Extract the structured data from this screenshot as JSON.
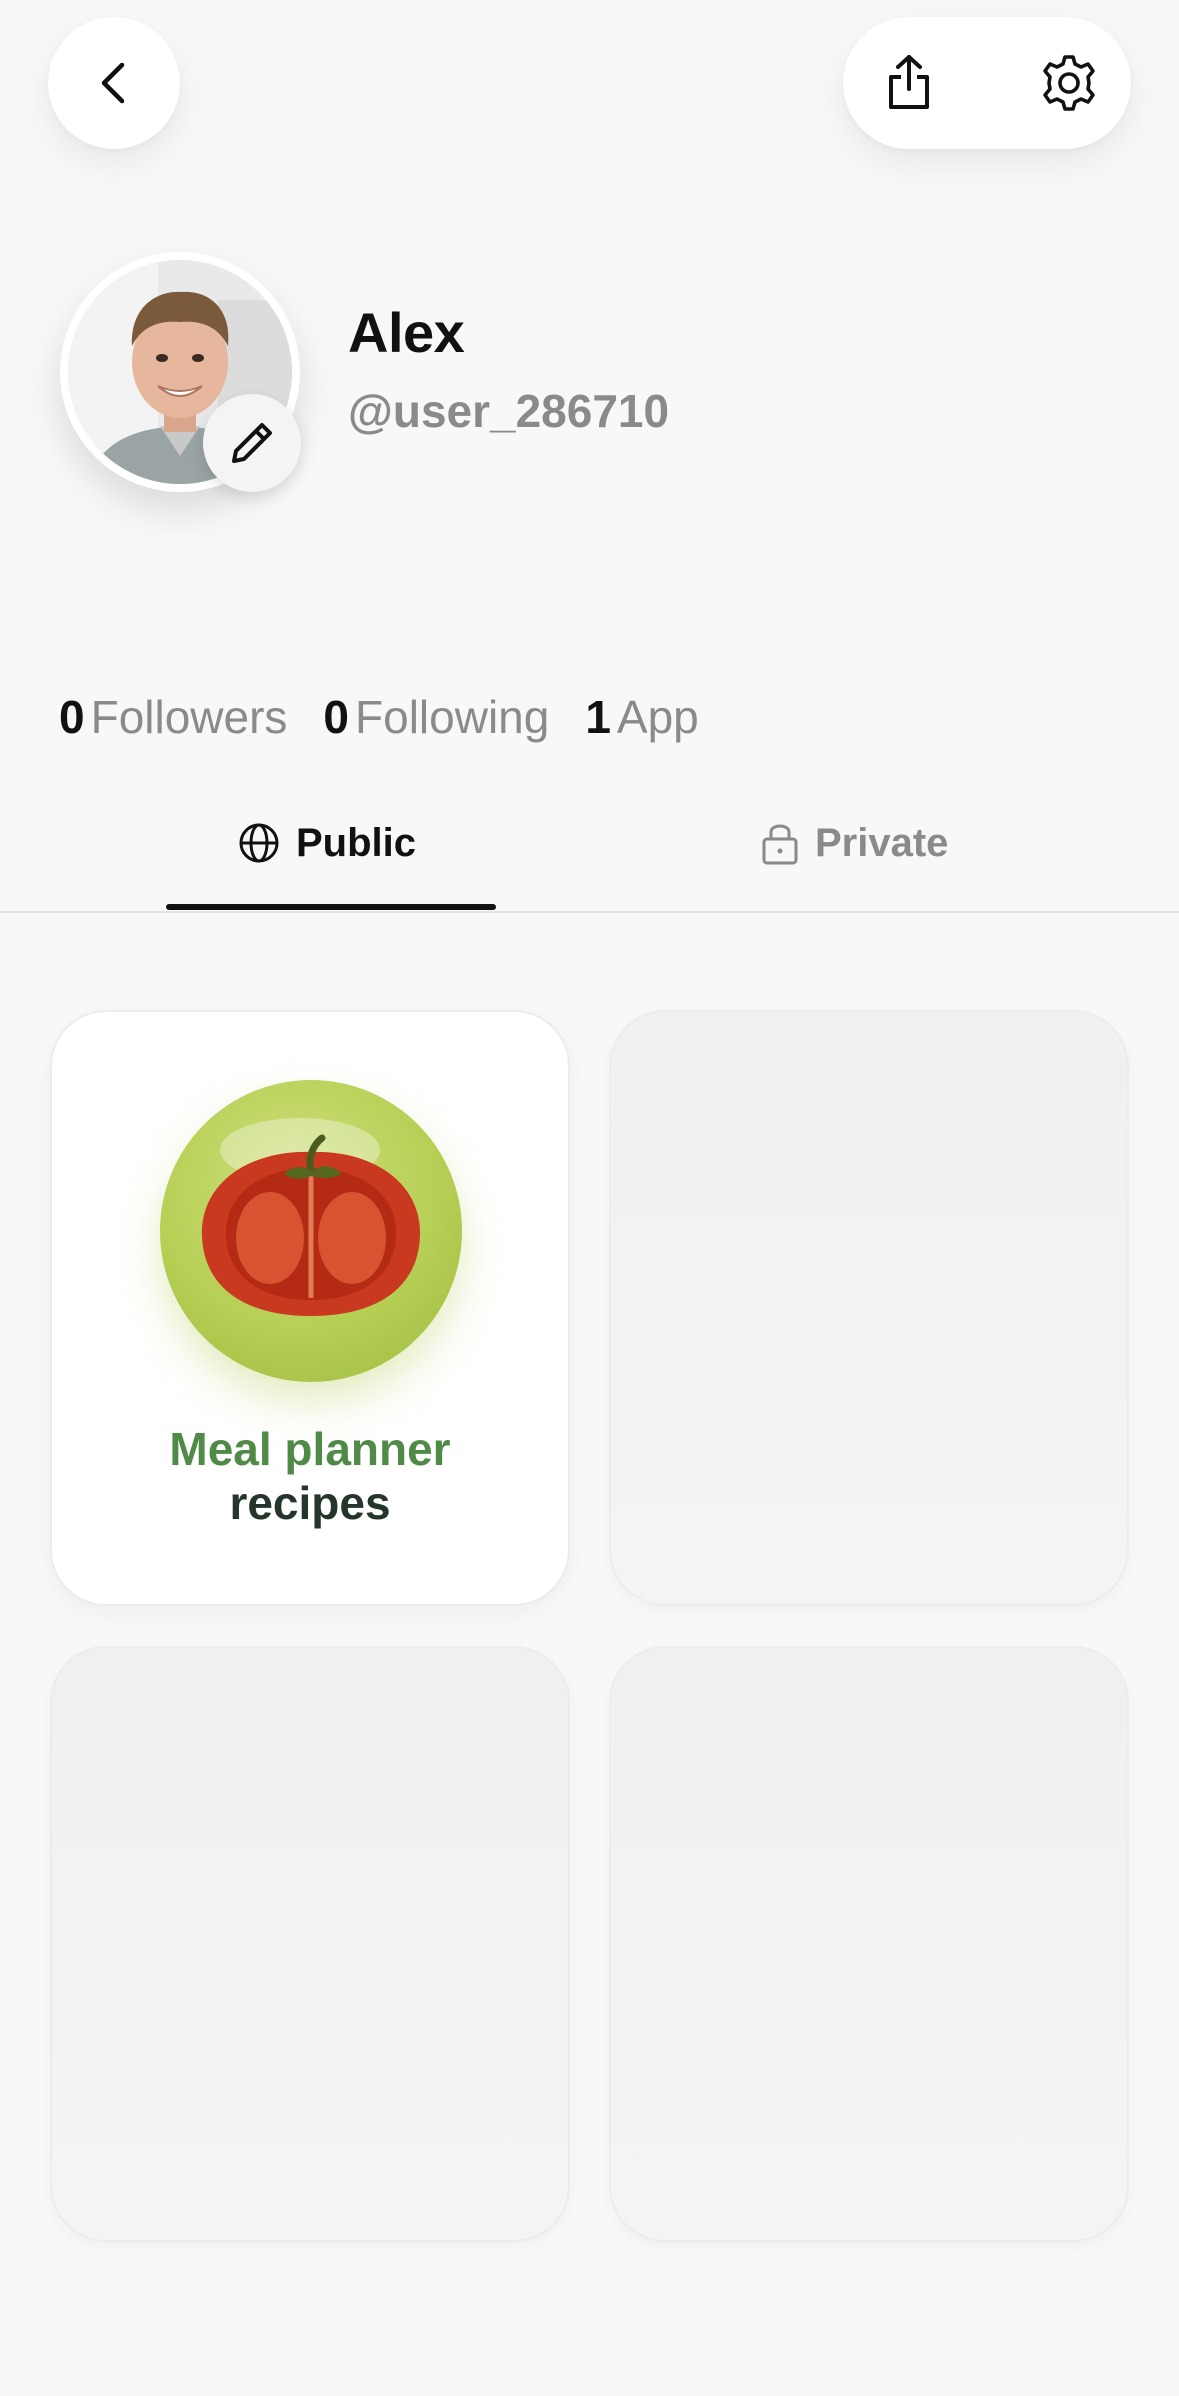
{
  "header": {
    "back_icon": "chevron-left-icon",
    "share_icon": "share-icon",
    "settings_icon": "gear-icon"
  },
  "profile": {
    "name": "Alex",
    "username": "@user_286710",
    "edit_icon": "pencil-icon"
  },
  "stats": [
    {
      "value": "0",
      "label": "Followers"
    },
    {
      "value": "0",
      "label": "Following"
    },
    {
      "value": "1",
      "label": "App"
    }
  ],
  "tabs": [
    {
      "label": "Public",
      "icon": "globe-icon",
      "active": true
    },
    {
      "label": "Private",
      "icon": "lock-icon",
      "active": false
    }
  ],
  "apps": [
    {
      "title_line1": "Meal planner",
      "title_line2": "recipes",
      "icon": "tomato-icon"
    }
  ],
  "colors": {
    "background": "#f8f8f8",
    "text_primary": "#111111",
    "text_muted": "#8a8a8a",
    "app_title_green": "#4f8a47",
    "app_title_dark": "#24352a",
    "app_icon_bg": "#b6cf55"
  }
}
